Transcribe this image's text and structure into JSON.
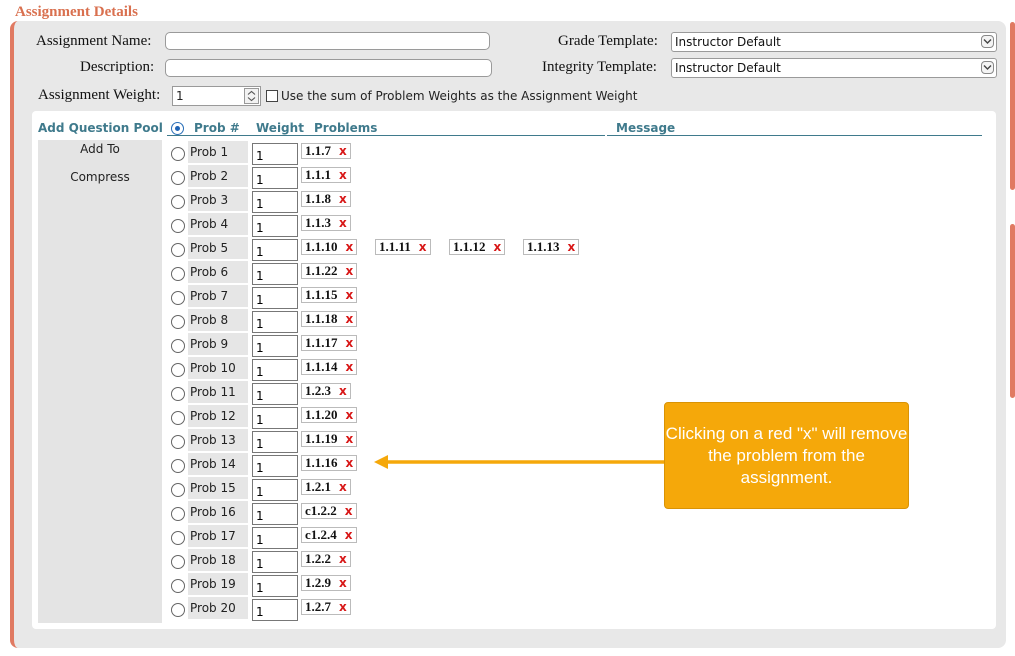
{
  "page_title": "Assignment Details",
  "form": {
    "assignment_name_label": "Assignment Name:",
    "assignment_name_value": "",
    "description_label": "Description:",
    "description_value": "",
    "grade_template_label": "Grade Template:",
    "grade_template_value": "Instructor Default",
    "integrity_template_label": "Integrity Template:",
    "integrity_template_value": "Instructor Default",
    "assignment_weight_label": "Assignment Weight:",
    "assignment_weight_value": "1",
    "use_sum_checkbox_checked": false,
    "use_sum_label": "Use the sum of Problem Weights as the Assignment Weight"
  },
  "table": {
    "headers": {
      "pool": "Add Question Pool",
      "prob": "Prob #",
      "weight": "Weight",
      "problems": "Problems",
      "message": "Message"
    },
    "left_actions": [
      "Add To",
      "Compress"
    ],
    "rows": [
      {
        "prob": "Prob 1",
        "weight": "1",
        "problems": [
          "1.1.7"
        ]
      },
      {
        "prob": "Prob 2",
        "weight": "1",
        "problems": [
          "1.1.1"
        ]
      },
      {
        "prob": "Prob 3",
        "weight": "1",
        "problems": [
          "1.1.8"
        ]
      },
      {
        "prob": "Prob 4",
        "weight": "1",
        "problems": [
          "1.1.3"
        ]
      },
      {
        "prob": "Prob 5",
        "weight": "1",
        "problems": [
          "1.1.10",
          "1.1.11",
          "1.1.12",
          "1.1.13"
        ]
      },
      {
        "prob": "Prob 6",
        "weight": "1",
        "problems": [
          "1.1.22"
        ]
      },
      {
        "prob": "Prob 7",
        "weight": "1",
        "problems": [
          "1.1.15"
        ]
      },
      {
        "prob": "Prob 8",
        "weight": "1",
        "problems": [
          "1.1.18"
        ]
      },
      {
        "prob": "Prob 9",
        "weight": "1",
        "problems": [
          "1.1.17"
        ]
      },
      {
        "prob": "Prob 10",
        "weight": "1",
        "problems": [
          "1.1.14"
        ]
      },
      {
        "prob": "Prob 11",
        "weight": "1",
        "problems": [
          "1.2.3"
        ]
      },
      {
        "prob": "Prob 12",
        "weight": "1",
        "problems": [
          "1.1.20"
        ]
      },
      {
        "prob": "Prob 13",
        "weight": "1",
        "problems": [
          "1.1.19"
        ]
      },
      {
        "prob": "Prob 14",
        "weight": "1",
        "problems": [
          "1.1.16"
        ]
      },
      {
        "prob": "Prob 15",
        "weight": "1",
        "problems": [
          "1.2.1"
        ]
      },
      {
        "prob": "Prob 16",
        "weight": "1",
        "problems": [
          "c1.2.2"
        ]
      },
      {
        "prob": "Prob 17",
        "weight": "1",
        "problems": [
          "c1.2.4"
        ]
      },
      {
        "prob": "Prob 18",
        "weight": "1",
        "problems": [
          "1.2.2"
        ]
      },
      {
        "prob": "Prob 19",
        "weight": "1",
        "problems": [
          "1.2.9"
        ]
      },
      {
        "prob": "Prob 20",
        "weight": "1",
        "problems": [
          "1.2.7"
        ]
      }
    ],
    "remove_symbol": "x"
  },
  "callout": {
    "text": "Clicking on a red \"x\" will remove the problem from the assignment."
  },
  "colors": {
    "title": "#d9704f",
    "accent": "#e07a62",
    "header_text": "#3f7a8c",
    "remove_x": "#d81818",
    "callout_bg": "#f5a80a"
  }
}
